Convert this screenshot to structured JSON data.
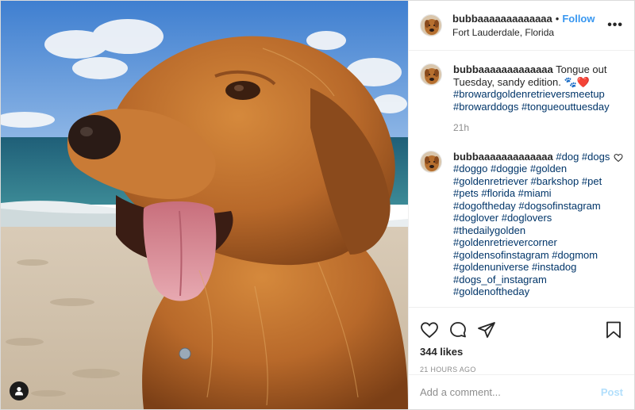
{
  "post": {
    "username": "bubbaaaaaaaaaaaaa",
    "dot": "•",
    "follow_label": "Follow",
    "location": "Fort Lauderdale, Florida",
    "more_label": "•••",
    "photo_icons": {
      "tag": "user-tag-icon"
    }
  },
  "comments": [
    {
      "username": "bubbaaaaaaaaaaaaa",
      "text": "Tongue out Tuesday, sandy edition. 🐾❤️",
      "hashtags": "#browardgoldenretrieversmeetup #browarddogs #tongueouttuesday",
      "time": "21h"
    },
    {
      "username": "bubbaaaaaaaaaaaaa",
      "hashtags": "#dog #dogs #doggo #doggie #golden #goldenretriever #barkshop #pet #pets #florida #miami #dogoftheday #dogsofinstagram #doglover #doglovers #thedailygolden #goldenretrievercorner #goldensofinstagram #dogmom #goldenuniverse #instadog #dogs_of_instagram #goldenoftheday"
    }
  ],
  "actions": {
    "icons": [
      "heart-icon",
      "comment-icon",
      "share-icon",
      "bookmark-icon"
    ],
    "likes": "344 likes",
    "time_ago": "21 HOURS AGO"
  },
  "composer": {
    "placeholder": "Add a comment...",
    "post_label": "Post"
  },
  "colors": {
    "accent": "#3897f0",
    "hashtag": "#003569",
    "post_disabled": "#b2dffc",
    "muted": "#8e8e8e"
  }
}
